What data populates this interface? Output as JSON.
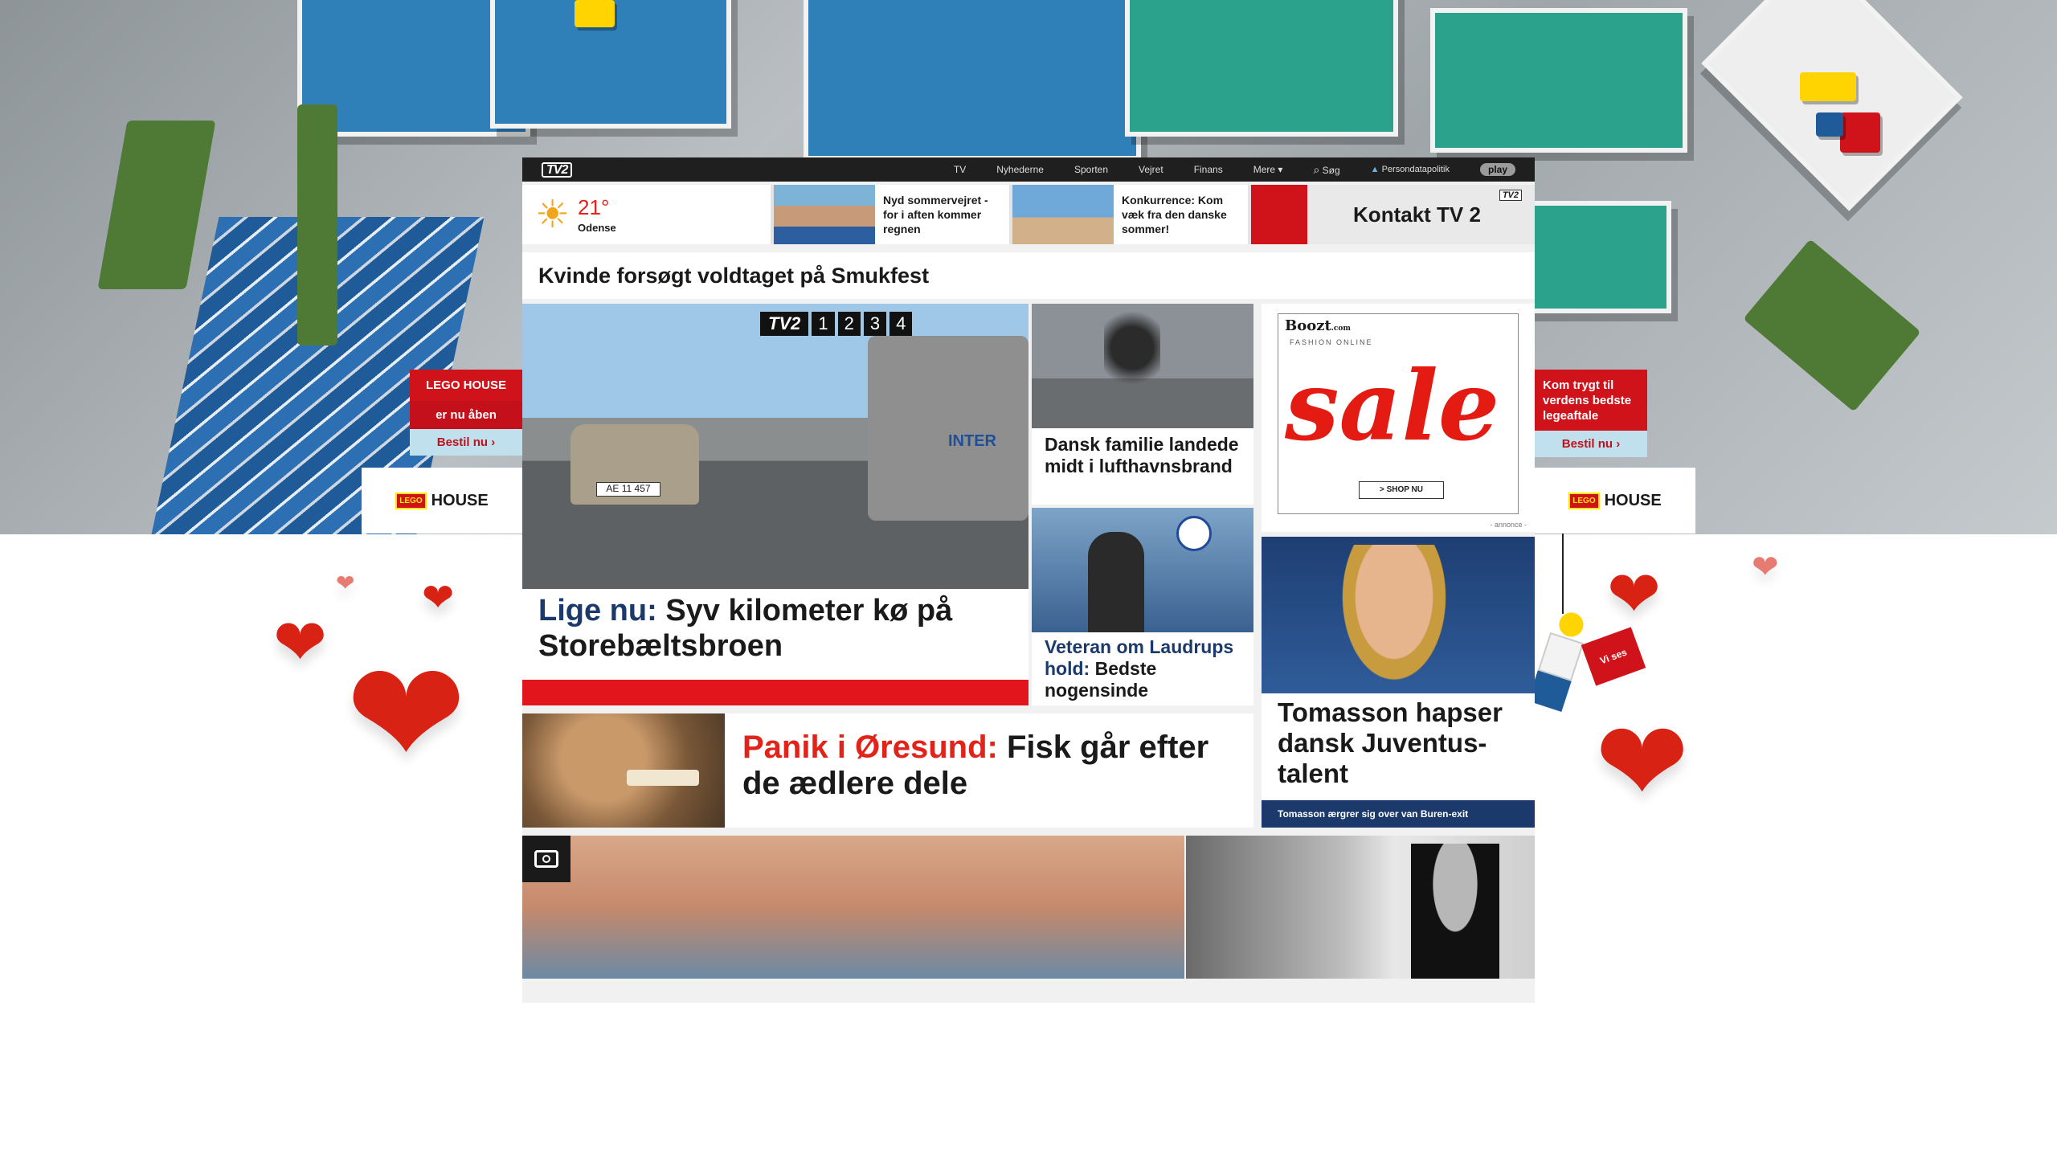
{
  "nav": {
    "logo": "TV2",
    "links": [
      "TV",
      "Nyhederne",
      "Sporten",
      "Vejret",
      "Finans",
      "Mere"
    ],
    "search": "Søg",
    "privacy": "Persondatapolitik",
    "play": "play"
  },
  "strip": {
    "temperature": "21°",
    "city": "Odense",
    "item1": "Nyd sommervejret - for i aften kommer regnen",
    "item2": "Konkurrence: Kom væk fra den danske sommer!",
    "contact": "Kontakt TV 2",
    "contact_logo": "TV2"
  },
  "top_headline": "Kvinde forsøgt voldtaget på Smukfest",
  "main_story": {
    "prefix": "Lige nu:",
    "text": "Syv kilometer kø på Storebæltsbroen",
    "badge": "TV2",
    "badge_digits": [
      "1",
      "2",
      "3",
      "4"
    ],
    "plate": "AE 11 457",
    "truck_text": "INTER"
  },
  "story2": "Dansk familie landede midt i lufthavnsbrand",
  "story3": {
    "prefix": "Veteran om Laudrups hold:",
    "text": "Bedste nogensinde"
  },
  "story4": {
    "prefix": "Panik i Øresund:",
    "text": "Fisk går efter de ædlere dele"
  },
  "story5": {
    "title": "Tomasson hapser dansk Juventus-talent",
    "sub": "Tomasson ærgrer sig over van Buren-exit"
  },
  "ad": {
    "brand": "Boozt",
    "brand_suffix": ".com",
    "tagline": "FASHION ONLINE",
    "word": "sale",
    "button": "> SHOP NU",
    "label": "- annonce -"
  },
  "left_ad": {
    "line1": "LEGO HOUSE",
    "line2": "er nu åben",
    "button": "Bestil nu",
    "logo_small": "LEGO",
    "logo": "HOUSE"
  },
  "right_ad": {
    "line1": "Kom trygt til verdens bedste legeaftale",
    "button": "Bestil nu",
    "logo_small": "LEGO",
    "logo": "HOUSE"
  },
  "flag_text": "Vi ses",
  "colors": {
    "accent_red": "#e2231a",
    "nav_bg": "#1f1f1f",
    "blue_heading": "#1b3a6b",
    "ad_red": "#d0121a"
  }
}
